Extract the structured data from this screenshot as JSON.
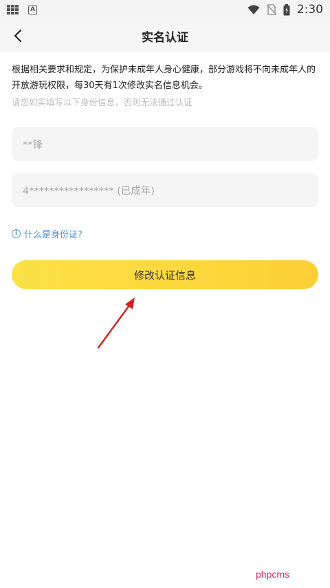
{
  "status_bar": {
    "time": "2:30",
    "notification_icon_label": "A",
    "icons": [
      "grid-icon",
      "a-notification-icon",
      "wifi-icon",
      "no-sim-icon",
      "battery-icon"
    ]
  },
  "header": {
    "title": "实名认证",
    "back_icon": "back-arrow-icon"
  },
  "notice": {
    "text": "根据相关要求和规定，为保护未成年人身心健康，部分游戏将不向未成年人的开放游玩权限，每30天有1次修改实名信息机会。",
    "hint": "请您如实填写以下身份信息，否则无法通过认证"
  },
  "form": {
    "name_value": "**锋",
    "id_value": "4***************** (已成年)"
  },
  "help": {
    "label": "什么是身份证?",
    "icon_glyph": "i",
    "icon": "info-icon"
  },
  "submit": {
    "label": "修改认证信息"
  },
  "watermark": {
    "text": "phpcms"
  },
  "colors": {
    "accent_yellow": "#fdd83c",
    "link_blue": "#4a90d9",
    "arrow_red": "#d42020",
    "watermark_pink": "#d3286b"
  }
}
